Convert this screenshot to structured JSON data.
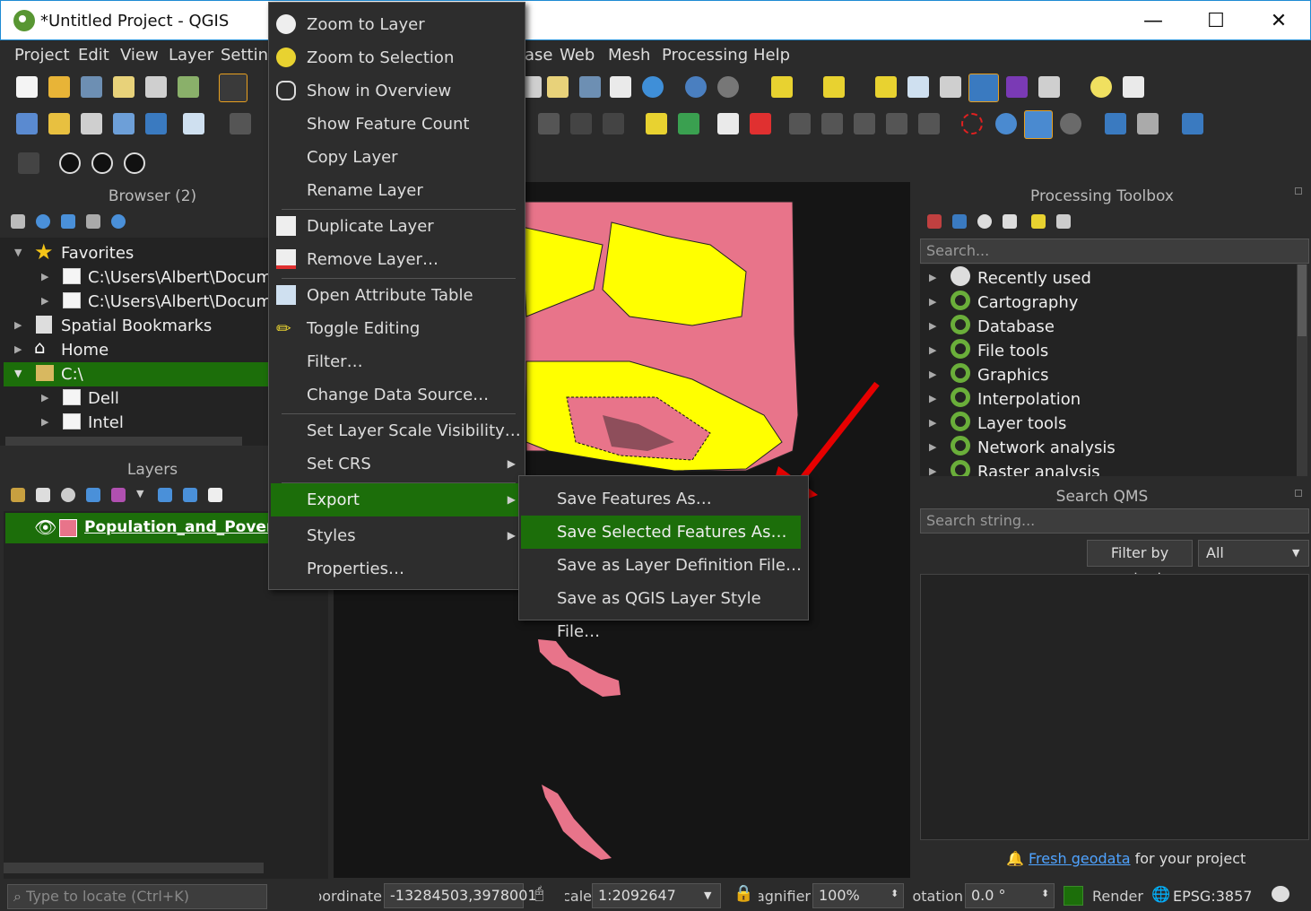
{
  "window": {
    "title": "*Untitled Project - QGIS",
    "minimize": "—",
    "maximize": "☐",
    "close": "✕"
  },
  "menubar": [
    "Project",
    "Edit",
    "View",
    "Layer",
    "Setting",
    "ase",
    "Web",
    "Mesh",
    "Processing",
    "Help"
  ],
  "browser": {
    "title": "Browser (2)",
    "items": [
      {
        "label": "Favorites"
      },
      {
        "label": "C:\\Users\\Albert\\Documer"
      },
      {
        "label": "C:\\Users\\Albert\\Documer"
      },
      {
        "label": "Spatial Bookmarks"
      },
      {
        "label": "Home"
      },
      {
        "label": "C:\\"
      },
      {
        "label": "Dell"
      },
      {
        "label": "Intel"
      }
    ]
  },
  "layers": {
    "title": "Layers",
    "layer_name": "Population_and_Poverty"
  },
  "context_menu": {
    "items": [
      "Zoom to Layer",
      "Zoom to Selection",
      "Show in Overview",
      "Show Feature Count",
      "Copy Layer",
      "Rename Layer",
      "Duplicate Layer",
      "Remove Layer…",
      "Open Attribute Table",
      "Toggle Editing",
      "Filter…",
      "Change Data Source…",
      "Set Layer Scale Visibility…",
      "Set CRS",
      "Export",
      "Styles",
      "Properties…"
    ]
  },
  "export_submenu": {
    "items": [
      "Save Features As…",
      "Save Selected Features As…",
      "Save as Layer Definition File…",
      "Save as QGIS Layer Style File…"
    ]
  },
  "processing": {
    "title": "Processing Toolbox",
    "search_placeholder": "Search...",
    "items": [
      "Recently used",
      "Cartography",
      "Database",
      "File tools",
      "Graphics",
      "Interpolation",
      "Layer tools",
      "Network analysis",
      "Raster analysis"
    ]
  },
  "qms": {
    "title": "Search QMS",
    "search_placeholder": "Search string...",
    "filter_label": "Filter by extent",
    "filter_value": "All",
    "footer_link": "Fresh geodata",
    "footer_text": "for your project"
  },
  "statusbar": {
    "locate_placeholder": "Type to locate (Ctrl+K)",
    "coord_label": "Coordinate",
    "coord_value": "-13284503,3978001",
    "scale_label": "Scale",
    "scale_value": "1:2092647",
    "magnifier_label": "Magnifier",
    "magnifier_value": "100%",
    "rotation_label": "Rotation",
    "rotation_value": "0.0 °",
    "render_label": "Render",
    "crs": "EPSG:3857"
  },
  "colors": {
    "highlight": "#1c6e0a",
    "accent_red": "#e60000",
    "map_pink": "#e8748a",
    "map_yellow": "#ffff00",
    "link": "#4fa3ff"
  }
}
